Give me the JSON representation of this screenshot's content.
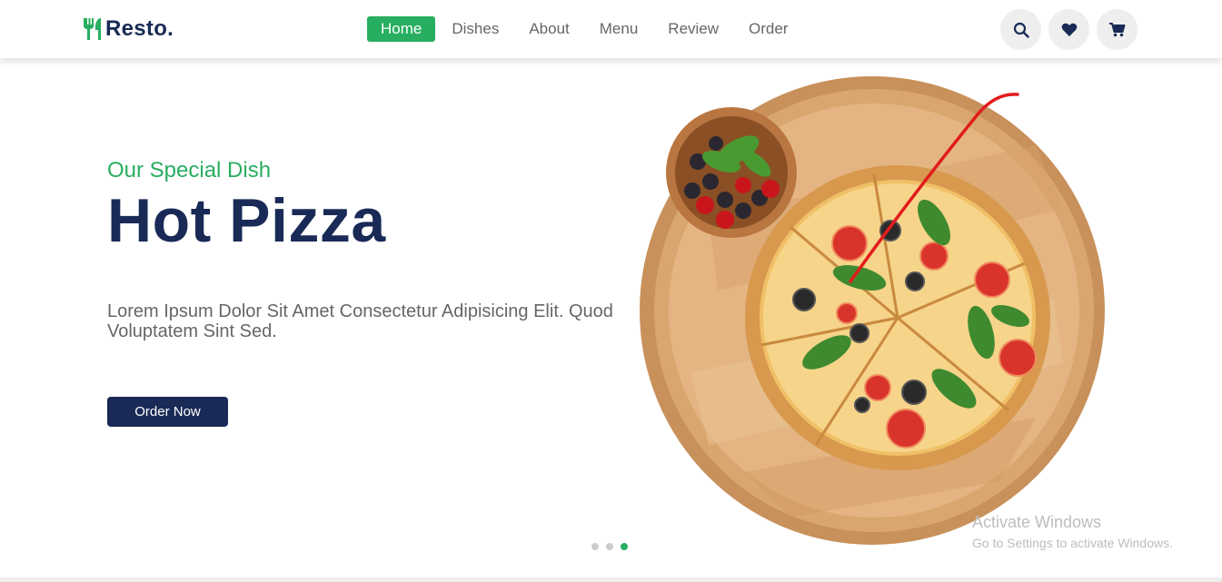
{
  "logo": {
    "text": "Resto.",
    "icon": "utensils-icon"
  },
  "nav": {
    "items": [
      "Home",
      "Dishes",
      "About",
      "Menu",
      "Review",
      "Order"
    ],
    "active": "Home"
  },
  "header_icons": [
    "search-icon",
    "heart-icon",
    "cart-icon"
  ],
  "hero": {
    "subtitle": "Our Special Dish",
    "title": "Hot Pizza",
    "description": "Lorem Ipsum Dolor Sit Amet Consectetur Adipisicing Elit. Quod Voluptatem Sint Sed.",
    "button_label": "Order Now"
  },
  "slider": {
    "count": 3,
    "active": 3
  },
  "watermark": {
    "title": "Activate Windows",
    "subtitle": "Go to Settings to activate Windows."
  },
  "colors": {
    "accent": "#27ae60",
    "dark": "#192a56",
    "text": "#666666"
  }
}
